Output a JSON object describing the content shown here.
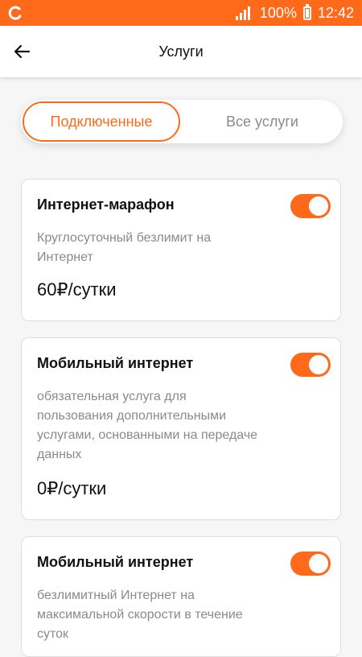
{
  "status_bar": {
    "battery_text": "100%",
    "time": "12:42",
    "icons": [
      "operator-logo-icon",
      "signal-icon",
      "battery-icon"
    ]
  },
  "header": {
    "title": "Услуги",
    "back_icon": "arrow-left-icon"
  },
  "tabs": {
    "connected": "Подключенные",
    "all": "Все услуги",
    "active": "connected"
  },
  "services": [
    {
      "title": "Интернет-марафон",
      "description": "Круглосуточный безлимит на Интернет",
      "price": "60₽/сутки",
      "enabled": true
    },
    {
      "title": "Мобильный интернет",
      "description": "обязательная услуга для пользования дополнительными услугами, основанными на передаче данных",
      "price": "0₽/сутки",
      "enabled": true
    },
    {
      "title": "Мобильный интернет",
      "description": "безлимитный Интернет на максимальной скорости в течение суток",
      "price": "",
      "enabled": true
    }
  ],
  "colors": {
    "accent": "#ff6a1a",
    "text_primary": "#111111",
    "text_secondary": "#8a8a8a",
    "background": "#f6f6f6"
  }
}
